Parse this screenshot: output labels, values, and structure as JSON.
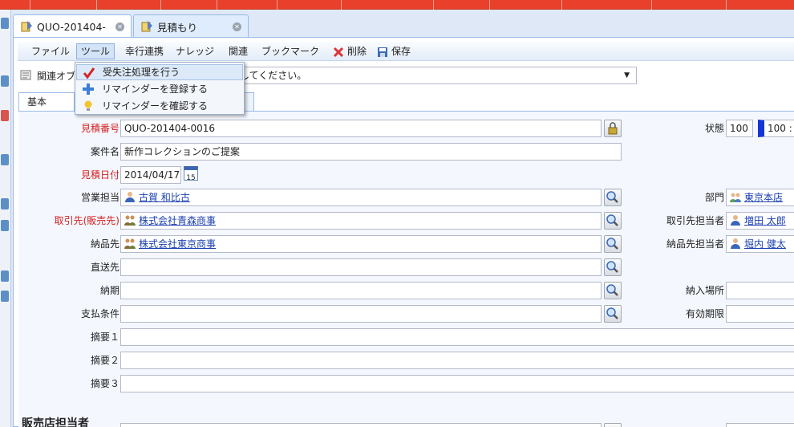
{
  "tabs": [
    {
      "label": "QUO-201404-"
    },
    {
      "label": "見積もり"
    }
  ],
  "menu": {
    "file": "ファイル",
    "tool": "ツール",
    "workflow": "幸行連携",
    "knowledge": "ナレッジ",
    "related": "関連",
    "bookmark": "ブックマーク",
    "delete": "削除",
    "save": "保存"
  },
  "dropdown": {
    "items": [
      {
        "label": "受失注処理を行う"
      },
      {
        "label": "リマインダーを登録する"
      },
      {
        "label": "リマインダーを確認する"
      }
    ]
  },
  "related_bar": {
    "label": "関連オブ",
    "select_text": "択してください。"
  },
  "form_tabs": {
    "basic": "基本"
  },
  "form": {
    "quote_no": {
      "label": "見積番号",
      "value": "QUO-201404-0016"
    },
    "subject": {
      "label": "案件名",
      "value": "新作コレクションのご提案"
    },
    "quote_date": {
      "label": "見積日付",
      "value": "2014/04/17",
      "cal": "15"
    },
    "sales_rep": {
      "label": "営業担当",
      "value": "古賀 和比古"
    },
    "customer": {
      "label": "取引先(販売先)",
      "value": "株式会社青森商事"
    },
    "delivery_to": {
      "label": "納品先",
      "value": "株式会社東京商事"
    },
    "direct_to": {
      "label": "直送先",
      "value": ""
    },
    "delivery_date": {
      "label": "納期",
      "value": ""
    },
    "payment_terms": {
      "label": "支払条件",
      "value": ""
    },
    "summary1": {
      "label": "摘要１",
      "value": ""
    },
    "summary2": {
      "label": "摘要２",
      "value": ""
    },
    "summary3": {
      "label": "摘要３",
      "value": ""
    },
    "status": {
      "label": "状態",
      "value": "100",
      "value2": "100 :"
    },
    "department": {
      "label": "部門",
      "value": "東京本店"
    },
    "customer_contact": {
      "label": "取引先担当者",
      "value": "増田 太郎"
    },
    "delivery_contact": {
      "label": "納品先担当者",
      "value": "堀内 健太"
    },
    "delivery_place": {
      "label": "納入場所",
      "value": ""
    },
    "validity": {
      "label": "有効期限",
      "value": ""
    }
  },
  "section": {
    "title": "販売店担当者"
  },
  "colors": {
    "accent_red": "#e8402a",
    "panel_border": "#99bbe8",
    "link_blue": "#1a3fb0",
    "required_red": "#d62020"
  }
}
